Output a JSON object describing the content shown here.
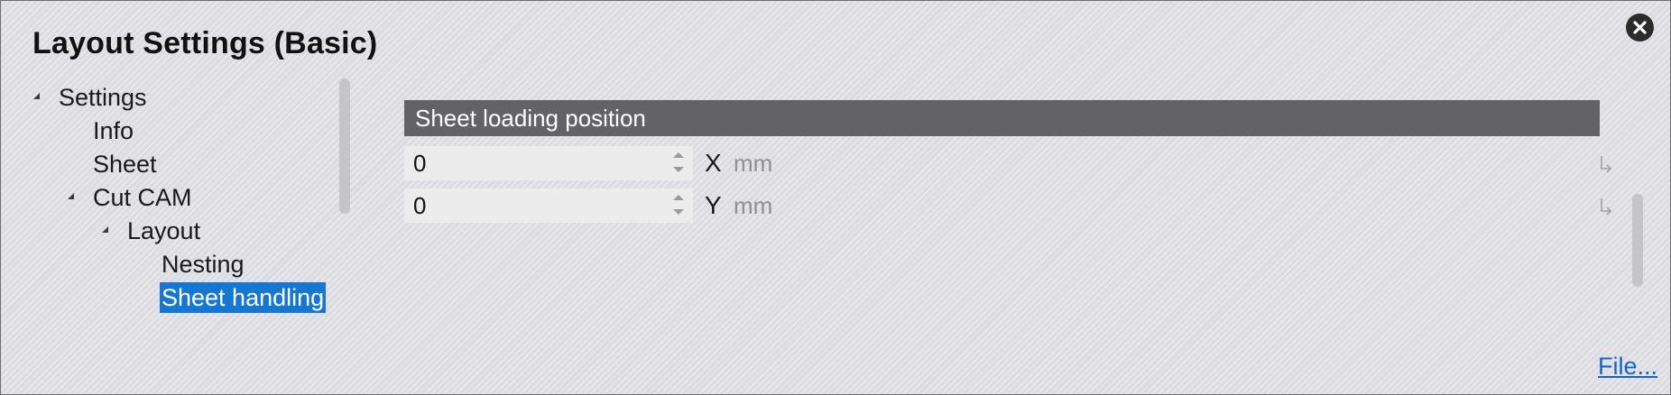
{
  "window": {
    "title": "Layout Settings (Basic)"
  },
  "tree": {
    "items": [
      {
        "label": "Settings",
        "expanded": true,
        "level": 0
      },
      {
        "label": "Info",
        "level": 1
      },
      {
        "label": "Sheet",
        "level": 1
      },
      {
        "label": "Cut CAM",
        "expanded": true,
        "level": 1
      },
      {
        "label": "Layout",
        "expanded": true,
        "level": 2
      },
      {
        "label": "Nesting",
        "level": 3
      },
      {
        "label": "Sheet handling",
        "level": 3,
        "selected": true
      }
    ]
  },
  "panel": {
    "section_title": "Sheet loading position",
    "fields": [
      {
        "value": "0",
        "axis": "X",
        "unit": "mm"
      },
      {
        "value": "0",
        "axis": "Y",
        "unit": "mm"
      }
    ]
  },
  "footer": {
    "file_link": "File..."
  },
  "colors": {
    "selection": "#1677d2",
    "section_header": "#636367",
    "link": "#1565c8"
  },
  "icons": {
    "close": "close-circle-icon",
    "expander": "expanded-triangle-icon",
    "reset": "reset-arrow-icon",
    "spinner": "spinner-arrows-icon"
  }
}
